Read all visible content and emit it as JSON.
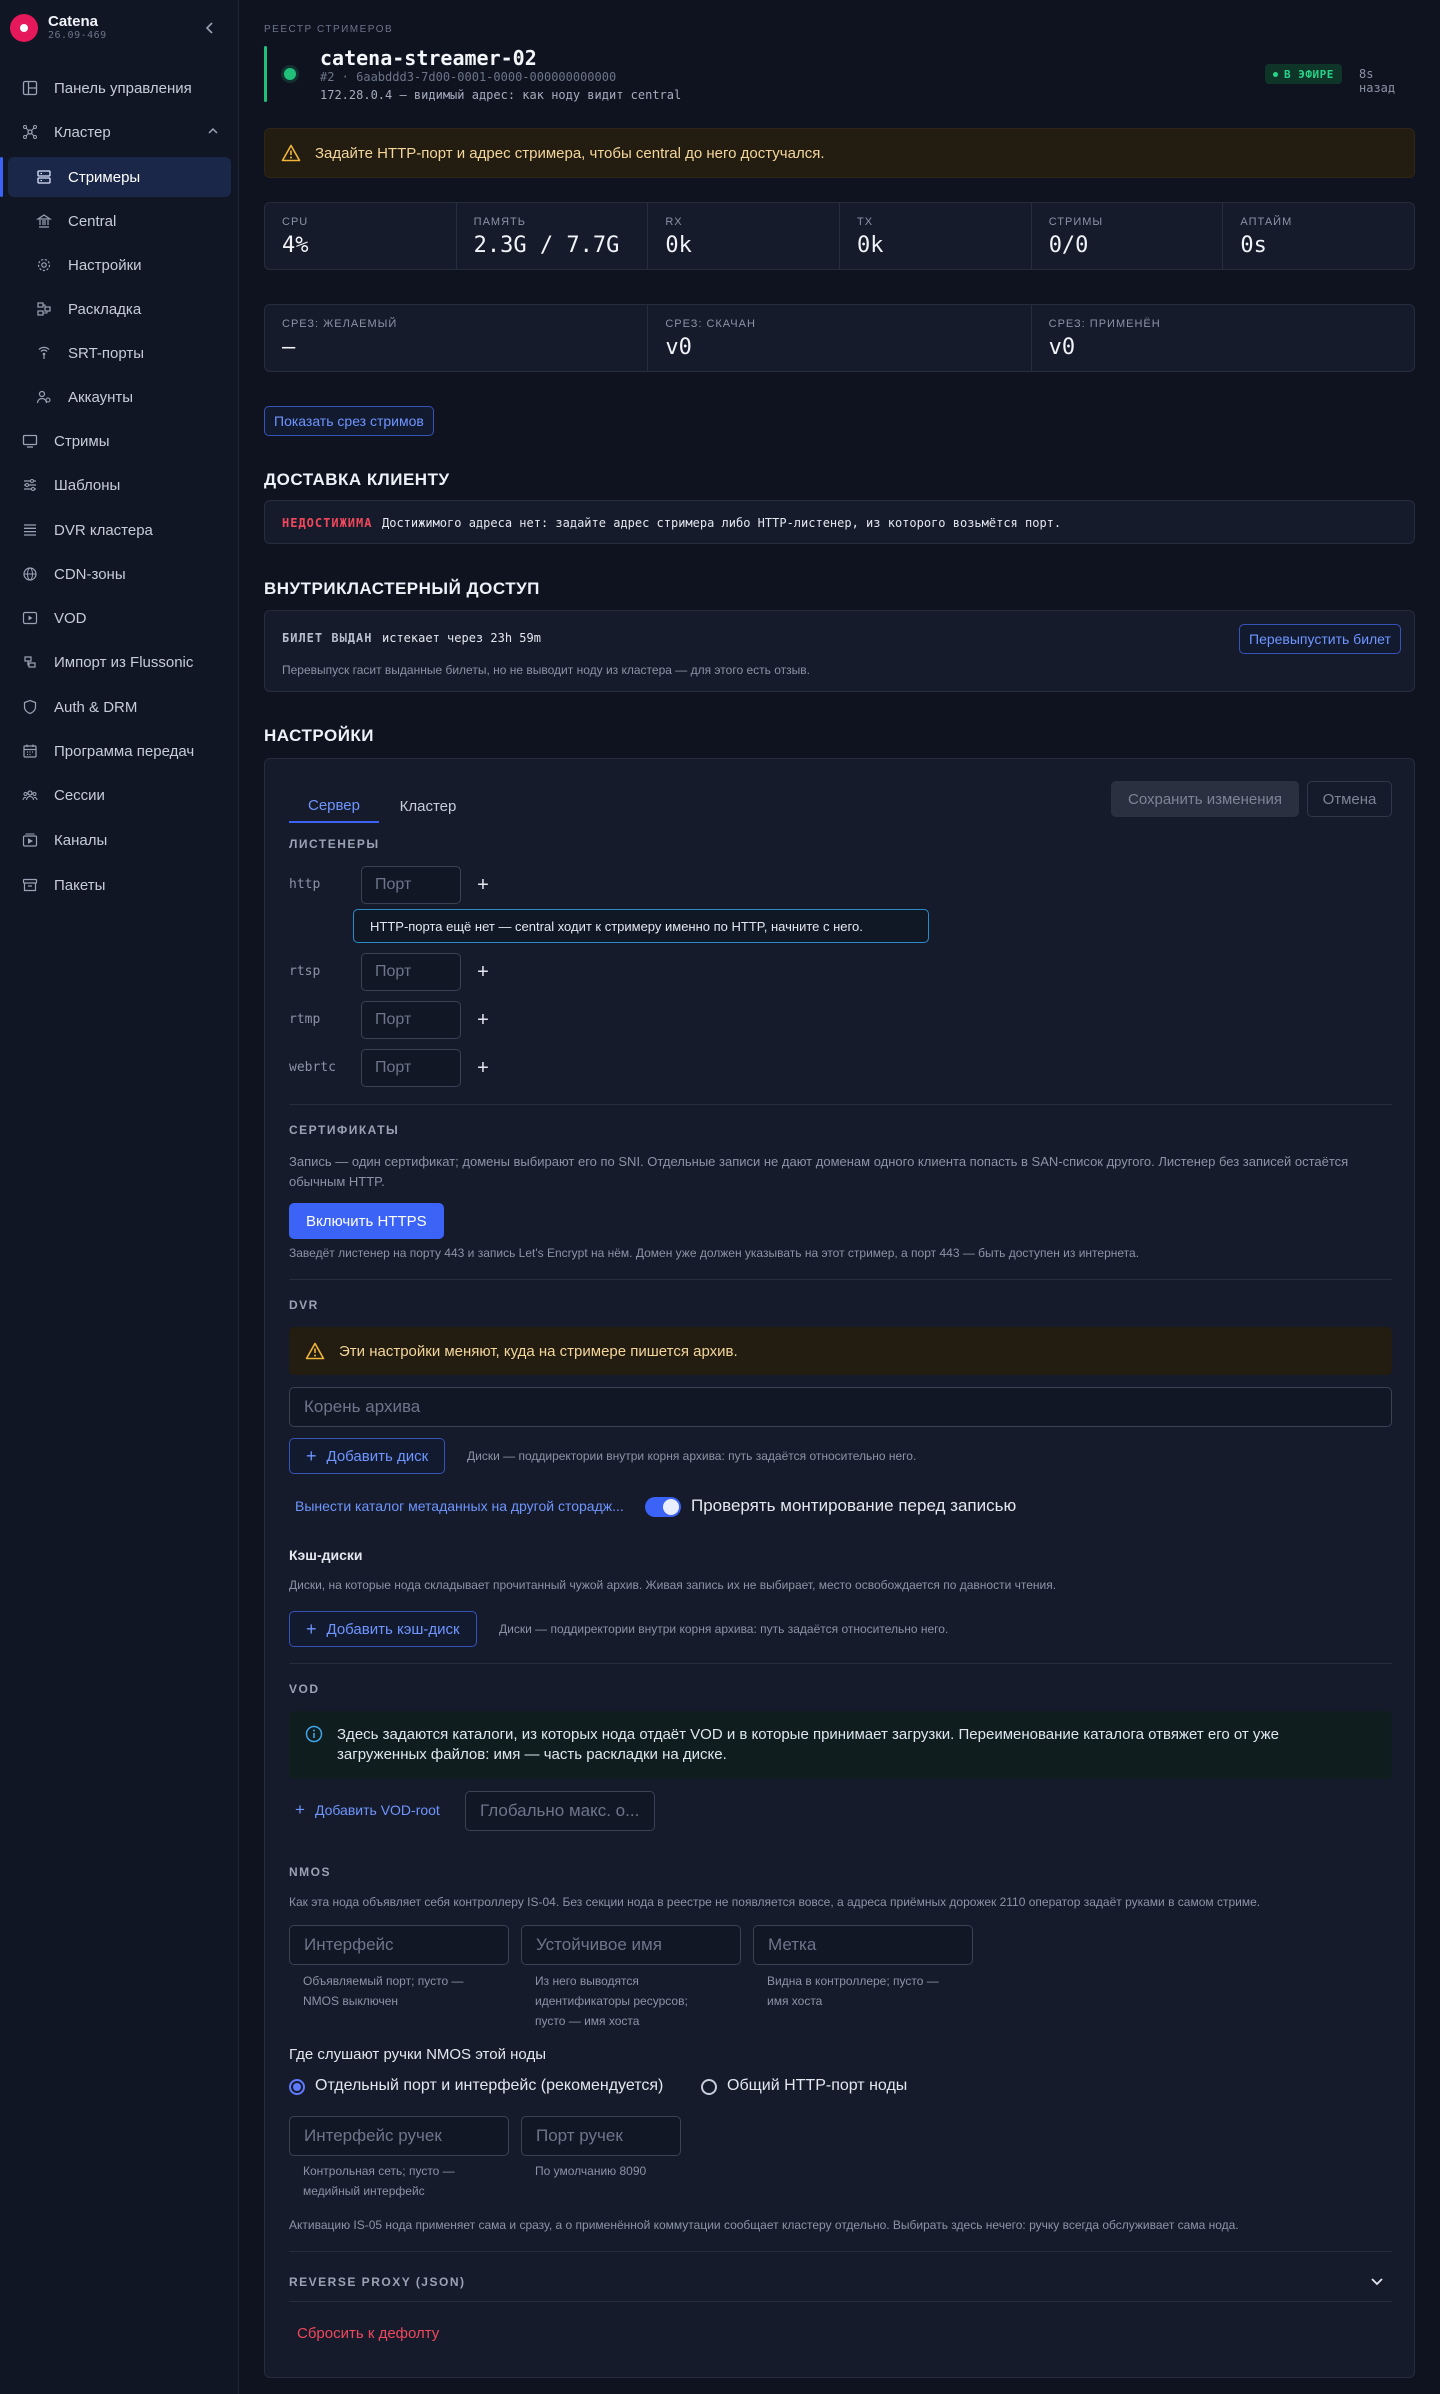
{
  "sidebar": {
    "app_name": "Catena",
    "version": "26.09-469",
    "items": [
      {
        "label": "Панель управления",
        "icon": "dashboard-icon"
      },
      {
        "label": "Кластер",
        "icon": "cluster-icon"
      },
      {
        "label": "Стримеры",
        "icon": "server-icon",
        "active": true
      },
      {
        "label": "Central",
        "icon": "bank-icon"
      },
      {
        "label": "Настройки",
        "icon": "gear-icon"
      },
      {
        "label": "Раскладка",
        "icon": "layout-icon"
      },
      {
        "label": "SRT-порты",
        "icon": "antenna-icon"
      },
      {
        "label": "Аккаунты",
        "icon": "accounts-icon"
      },
      {
        "label": "Стримы",
        "icon": "monitor-icon"
      },
      {
        "label": "Шаблоны",
        "icon": "sliders-icon"
      },
      {
        "label": "DVR кластера",
        "icon": "storage-icon"
      },
      {
        "label": "CDN-зоны",
        "icon": "globe-icon"
      },
      {
        "label": "VOD",
        "icon": "video-icon"
      },
      {
        "label": "Импорт из Flussonic",
        "icon": "import-icon"
      },
      {
        "label": "Auth & DRM",
        "icon": "shield-icon"
      },
      {
        "label": "Программа передач",
        "icon": "calendar-icon"
      },
      {
        "label": "Сессии",
        "icon": "users-icon"
      },
      {
        "label": "Каналы",
        "icon": "channels-icon"
      },
      {
        "label": "Пакеты",
        "icon": "archive-icon"
      }
    ]
  },
  "header": {
    "breadcrumb": "РЕЕСТР СТРИМЕРОВ",
    "host_name": "catena-streamer-02",
    "host_id": "#2 · 6aabddd3-7d00-0001-0000-000000000000",
    "host_addr": "172.28.0.4 — видимый адрес: как ноду видит central",
    "status": "В ЭФИРЕ",
    "updated": "8s назад"
  },
  "warning": "Задайте HTTP-порт и адрес стримера, чтобы central до него достучался.",
  "stats": [
    {
      "label": "CPU",
      "value": "4%"
    },
    {
      "label": "ПАМЯТЬ",
      "value": "2.3G / 7.7G"
    },
    {
      "label": "RX",
      "value": "0k"
    },
    {
      "label": "TX",
      "value": "0k"
    },
    {
      "label": "СТРИМЫ",
      "value": "0/0"
    },
    {
      "label": "АПТАЙМ",
      "value": "0s"
    }
  ],
  "slices": [
    {
      "label": "СРЕЗ: ЖЕЛАЕМЫЙ",
      "value": "—"
    },
    {
      "label": "СРЕЗ: СКАЧАН",
      "value": "v0"
    },
    {
      "label": "СРЕЗ: ПРИМЕНЁН",
      "value": "v0"
    }
  ],
  "show_slice_button": "Показать срез стримов",
  "delivery": {
    "title": "ДОСТАВКА КЛИЕНТУ",
    "tag": "НЕДОСТИЖИМА",
    "text": "Достижимого адреса нет: задайте адрес стримера либо HTTP-листенер, из которого возьмётся порт."
  },
  "intracluster": {
    "title": "ВНУТРИКЛАСТЕРНЫЙ ДОСТУП",
    "tag": "БИЛЕТ ВЫДАН",
    "expires": "истекает через 23h 59m",
    "reissue_button": "Перевыпустить билет",
    "note": "Перевыпуск гасит выданные билеты, но не выводит ноду из кластера — для этого есть отзыв."
  },
  "settings": {
    "title": "НАСТРОЙКИ",
    "tabs": [
      "Сервер",
      "Кластер"
    ],
    "save_button": "Сохранить изменения",
    "cancel_button": "Отмена",
    "listeners": {
      "title": "ЛИСТЕНЕРЫ",
      "port_placeholder": "Порт",
      "protocols": [
        "http",
        "rtsp",
        "rtmp",
        "webrtc"
      ],
      "hint": "HTTP-порта ещё нет — central ходит к стримеру именно по HTTP, начните с него."
    },
    "certs": {
      "title": "СЕРТИФИКАТЫ",
      "text": "Запись — один сертификат; домены выбирают его по SNI. Отдельные записи не дают доменам одного клиента попасть в SAN-список другого. Листенер без записей остаётся обычным HTTP.",
      "button": "Включить HTTPS",
      "note": "Заведёт листенер на порту 443 и запись Let's Encrypt на нём. Домен уже должен указывать на этот стример, а порт 443 — быть доступен из интернета."
    },
    "dvr": {
      "title": "DVR",
      "warning": "Эти настройки меняют, куда на стримере пишется архив.",
      "root_placeholder": "Корень архива",
      "add_disk": "Добавить диск",
      "disk_note": "Диски — поддиректории внутри корня архива: путь задаётся относительно него.",
      "metadata_link": "Вынести каталог метаданных на другой сторадж...",
      "mount_check_label": "Проверять монтирование перед записью",
      "cache_title": "Кэш-диски",
      "cache_text": "Диски, на которые нода складывает прочитанный чужой архив. Живая запись их не выбирает, место освобождается по давности чтения.",
      "add_cache": "Добавить кэш-диск",
      "cache_note": "Диски — поддиректории внутри корня архива: путь задаётся относительно него."
    },
    "vod": {
      "title": "VOD",
      "info": "Здесь задаются каталоги, из которых нода отдаёт VOD и в которые принимает загрузки. Переименование каталога отвяжет его от уже загруженных файлов: имя — часть раскладки на диске.",
      "add_root": "Добавить VOD-root",
      "global_max_placeholder": "Глобально макс. о..."
    },
    "nmos": {
      "title": "NMOS",
      "text": "Как эта нода объявляет себя контроллеру IS-04. Без секции нода в реестре не появляется вовсе, а адреса приёмных дорожек 2110 оператор задаёт руками в самом стриме.",
      "interface_placeholder": "Интерфейс",
      "interface_help": "Объявляемый порт; пусто — NMOS выключен",
      "stable_name_placeholder": "Устойчивое имя",
      "stable_name_help": "Из него выводятся идентификаторы ресурсов; пусто — имя хоста",
      "label_placeholder": "Метка",
      "label_help": "Видна в контроллере; пусто — имя хоста",
      "handles_title": "Где слушают ручки NMOS этой ноды",
      "option_separate": "Отдельный порт и интерфейс (рекомендуется)",
      "option_shared": "Общий HTTP-порт ноды",
      "handles_iface_placeholder": "Интерфейс ручек",
      "handles_iface_help": "Контрольная сеть; пусто — медийный интерфейс",
      "handles_port_placeholder": "Порт ручек",
      "handles_port_help": "По умолчанию 8090",
      "is05_note": "Активацию IS-05 нода применяет сама и сразу, а о применённой коммутации сообщает кластеру отдельно. Выбирать здесь нечего: ручку всегда обслуживает сама нода."
    },
    "reverse_proxy": "REVERSE PROXY (JSON)",
    "reset": "Сбросить к дефолту"
  }
}
